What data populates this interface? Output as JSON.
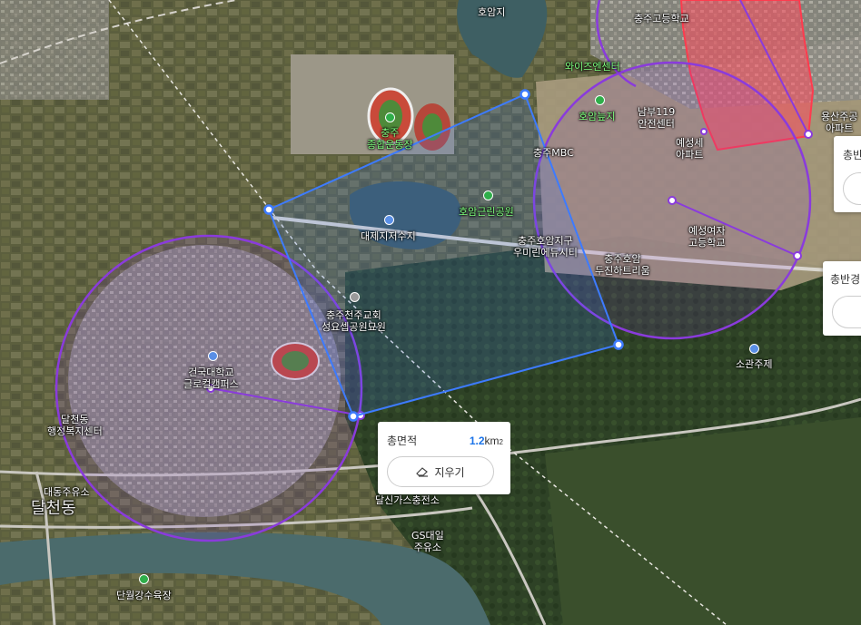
{
  "map": {
    "labels": [
      {
        "id": "homam-pond",
        "text": "호암지"
      },
      {
        "id": "chungju-high",
        "text": "충주고등학교"
      },
      {
        "id": "wise-center",
        "text": "와이즈엔센터"
      },
      {
        "id": "homam-wetland",
        "text": "호암늪지"
      },
      {
        "id": "namboo-119",
        "text": "남부119\n안전센터"
      },
      {
        "id": "yongsan-apt",
        "text": "용산주공\n아파트"
      },
      {
        "id": "chungju-stadium",
        "text": "충주\n종합운동장"
      },
      {
        "id": "chungju-mbc",
        "text": "충주MBC"
      },
      {
        "id": "yesung-apt",
        "text": "예성세\n아파트"
      },
      {
        "id": "homam-park",
        "text": "호암근린공원"
      },
      {
        "id": "daeje-reservoir",
        "text": "대제지저수지"
      },
      {
        "id": "udimel-city",
        "text": "충주호암지구\n우미린에듀시티"
      },
      {
        "id": "dusan-heritage",
        "text": "충주호암\n두진하트리움"
      },
      {
        "id": "yesung-girls",
        "text": "예성여자\n고등학교"
      },
      {
        "id": "cathedral",
        "text": "충주천주교회\n성요셉공원묘원"
      },
      {
        "id": "konkuk",
        "text": "건국대학교\n글로컬캠퍼스"
      },
      {
        "id": "sogwan-jeje",
        "text": "소관주제"
      },
      {
        "id": "dalcheon-center",
        "text": "달천동\n행정복지센터"
      },
      {
        "id": "daedong-gas",
        "text": "대동주유소"
      },
      {
        "id": "dalcheon-dong",
        "text": "달천동"
      },
      {
        "id": "dalsin-gas",
        "text": "달신가스충전소"
      },
      {
        "id": "gs-gas",
        "text": "GS대일\n주유소"
      },
      {
        "id": "danwol-field",
        "text": "단월강수육장"
      }
    ]
  },
  "measure_popup": {
    "label": "총면적",
    "value": "1.2",
    "unit": "km",
    "unit_sup": "2",
    "clear_label": "지우기"
  },
  "side_popups": [
    {
      "label": "총반경"
    },
    {
      "label": "총반경"
    }
  ],
  "colors": {
    "polygon_blue": "#3d7bff",
    "circle_purple": "#8a3bdc",
    "area_red": "#ff4b5c",
    "value_blue": "#1a73e8"
  }
}
